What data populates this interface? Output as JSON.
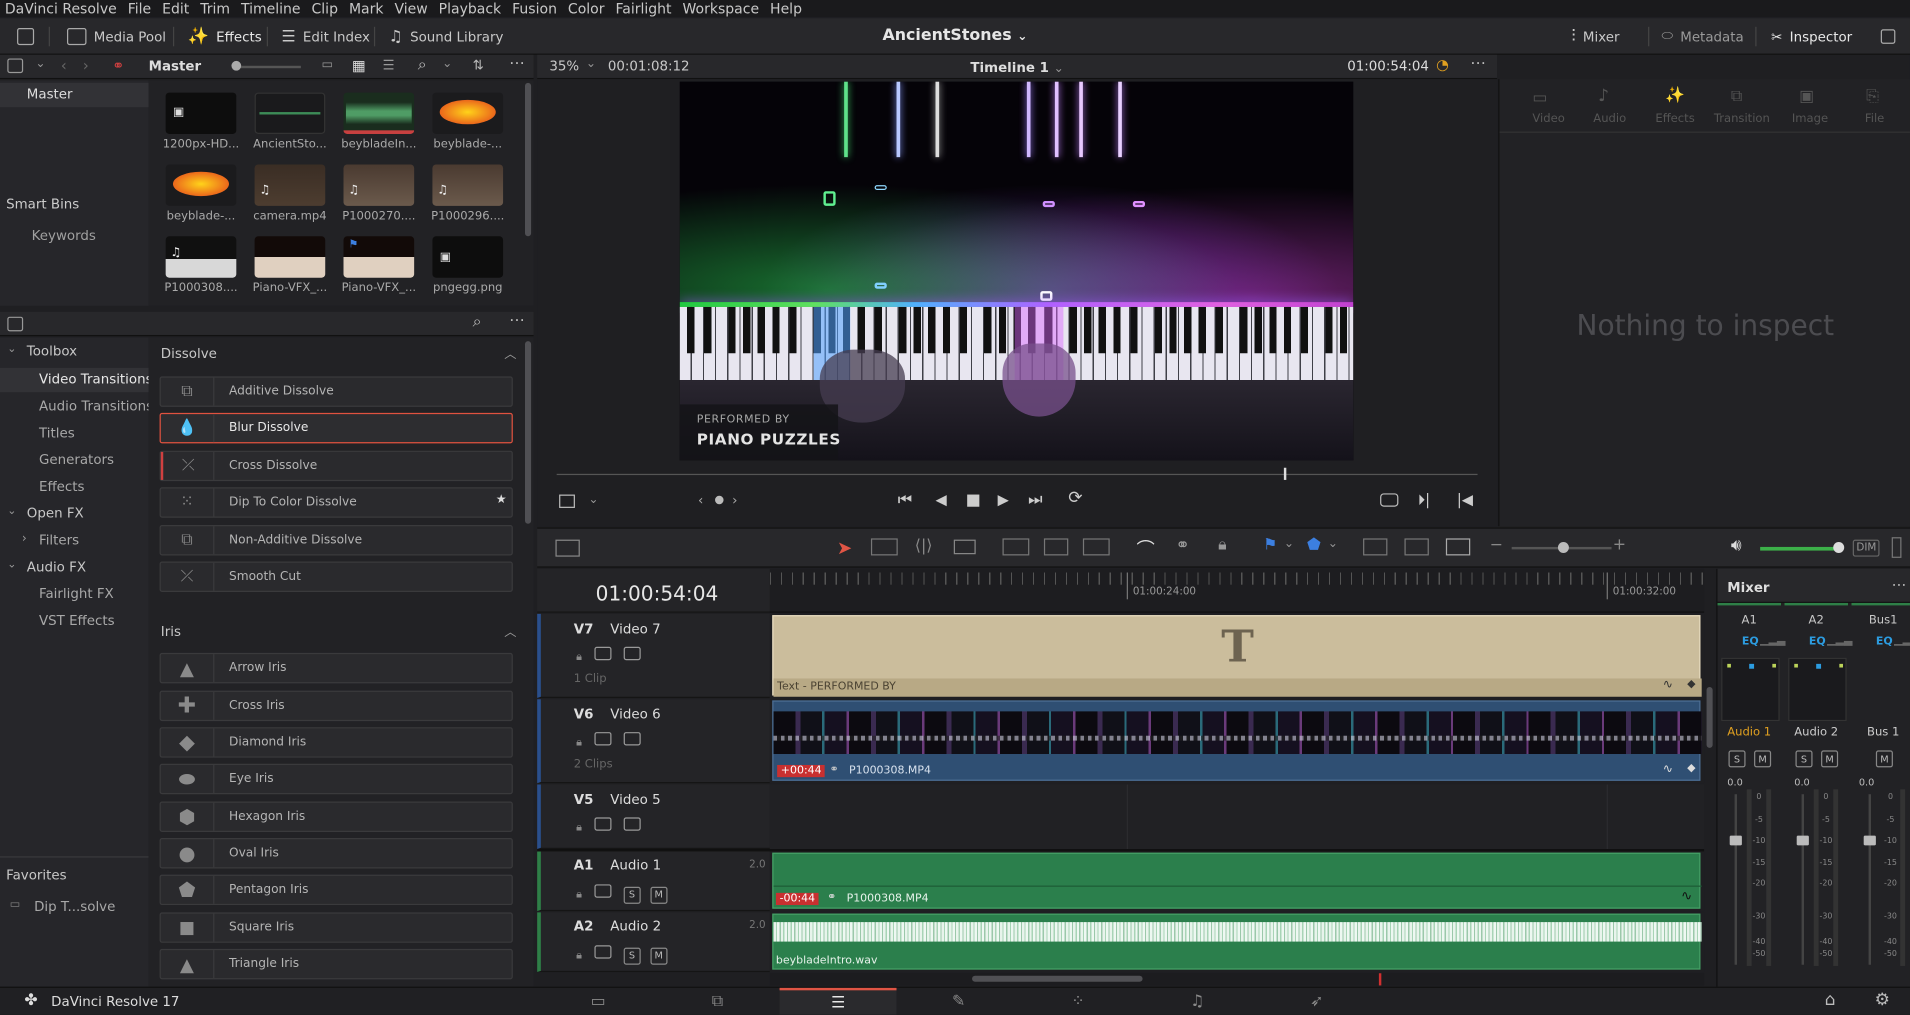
{
  "menu": [
    "DaVinci Resolve",
    "File",
    "Edit",
    "Trim",
    "Timeline",
    "Clip",
    "Mark",
    "View",
    "Playback",
    "Fusion",
    "Color",
    "Fairlight",
    "Workspace",
    "Help"
  ],
  "toolbar": {
    "media_pool": "Media Pool",
    "effects": "Effects",
    "edit_index": "Edit Index",
    "sound_library": "Sound Library",
    "project_title": "AncientStones",
    "mixer": "Mixer",
    "metadata": "Metadata",
    "inspector": "Inspector"
  },
  "media_pool": {
    "bin": "Master",
    "sidebar_master": "Master",
    "smart_bins": "Smart Bins",
    "keywords": "Keywords",
    "clips": [
      "1200px-HD...",
      "AncientSto...",
      "beybladeIn...",
      "beyblade-...",
      "beyblade-...",
      "camera.mp4",
      "P1000270....",
      "P1000296....",
      "P1000308....",
      "Piano-VFX_...",
      "Piano-VFX_...",
      "pngegg.png"
    ]
  },
  "effects": {
    "toolbox": "Toolbox",
    "tree": [
      "Video Transitions",
      "Audio Transitions",
      "Titles",
      "Generators",
      "Effects"
    ],
    "open_fx": "Open FX",
    "filters": "Filters",
    "audio_fx": "Audio FX",
    "audio_tree": [
      "Fairlight FX",
      "VST Effects"
    ],
    "favorites": "Favorites",
    "favorite_item": "Dip T...solve",
    "dissolve_header": "Dissolve",
    "dissolve": [
      "Additive Dissolve",
      "Blur Dissolve",
      "Cross Dissolve",
      "Dip To Color Dissolve",
      "Non-Additive Dissolve",
      "Smooth Cut"
    ],
    "iris_header": "Iris",
    "iris": [
      "Arrow Iris",
      "Cross Iris",
      "Diamond Iris",
      "Eye Iris",
      "Hexagon Iris",
      "Oval Iris",
      "Pentagon Iris",
      "Square Iris",
      "Triangle Iris"
    ]
  },
  "viewer": {
    "zoom": "35%",
    "duration": "00:01:08:12",
    "timeline_name": "Timeline 1",
    "timecode": "01:00:54:04",
    "overlay_small": "PERFORMED BY",
    "overlay_big": "PIANO PUZZLES",
    "progress": 0.79
  },
  "inspector": {
    "tabs": [
      "Video",
      "Audio",
      "Effects",
      "Transition",
      "Image",
      "File"
    ],
    "empty": "Nothing to inspect"
  },
  "timeline": {
    "timecode": "01:00:54:04",
    "ruler": [
      "01:00:24:00",
      "01:00:32:00"
    ],
    "tracks": [
      {
        "id": "V7",
        "name": "Video 7",
        "count": "1 Clip"
      },
      {
        "id": "V6",
        "name": "Video 6",
        "count": "2 Clips"
      },
      {
        "id": "V5",
        "name": "Video 5",
        "count": ""
      },
      {
        "id": "A1",
        "name": "Audio 1",
        "ch": "2.0"
      },
      {
        "id": "A2",
        "name": "Audio 2",
        "ch": "2.0"
      }
    ],
    "clip_text": "Text - PERFORMED BY",
    "clip_v6_offset": "+00:44",
    "clip_v6_name": "P1000308.MP4",
    "clip_a1_offset": "-00:44",
    "clip_a1_name": "P1000308.MP4",
    "clip_a2_name": "beybladeIntro.wav",
    "title_glyph": "T"
  },
  "mixer": {
    "title": "Mixer",
    "channels": [
      "A1",
      "A2",
      "Bus1"
    ],
    "eq": "EQ",
    "names": [
      "Audio 1",
      "Audio 2",
      "Bus 1"
    ],
    "value": "0.0",
    "scale": [
      "0",
      "-5",
      "-10",
      "-15",
      "-20",
      "-30",
      "-40",
      "-50"
    ],
    "dim": "DIM"
  },
  "footer": {
    "app": "DaVinci Resolve 17"
  }
}
